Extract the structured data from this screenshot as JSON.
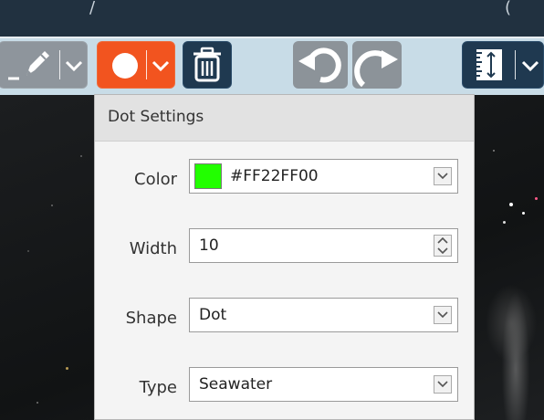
{
  "titlebar": {
    "left_fragment": "/",
    "right_fragment": "("
  },
  "toolbar": {
    "pen_icon": "pen-icon",
    "dot_icon": "dot-icon",
    "trash_icon": "trash-icon",
    "undo_icon": "undo-icon",
    "redo_icon": "redo-icon",
    "ruler_icon": "ruler-icon",
    "active_color": "#f2541f"
  },
  "dot_settings": {
    "title": "Dot Settings",
    "color": {
      "label": "Color",
      "value": "#FF22FF00",
      "swatch": "#22ff00"
    },
    "width": {
      "label": "Width",
      "value": "10"
    },
    "shape": {
      "label": "Shape",
      "value": "Dot"
    },
    "type": {
      "label": "Type",
      "value": "Seawater"
    }
  }
}
